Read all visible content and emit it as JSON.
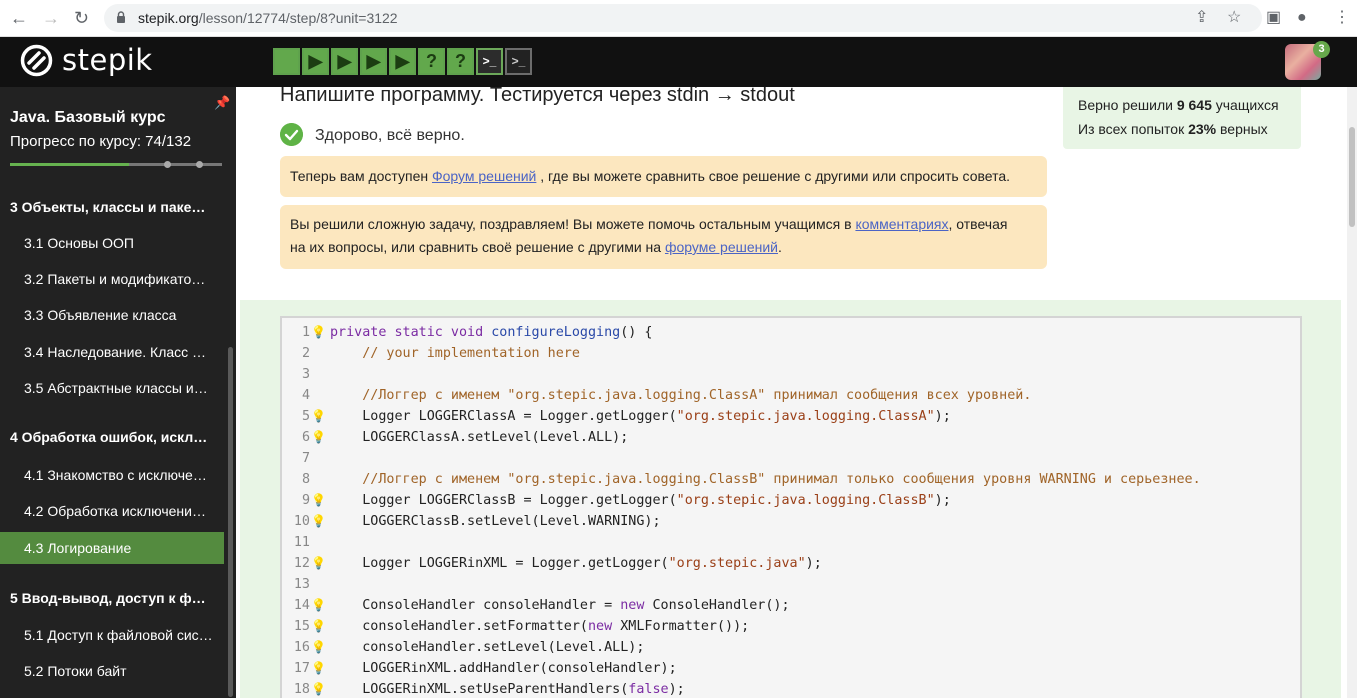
{
  "browser": {
    "url_host": "stepik.org",
    "url_path": "/lesson/12774/step/8?unit=3122"
  },
  "header": {
    "logo_text": "stepik",
    "step_buttons": [
      {
        "glyph": "",
        "kind": "green"
      },
      {
        "glyph": "▶",
        "kind": "green"
      },
      {
        "glyph": "▶",
        "kind": "green"
      },
      {
        "glyph": "▶",
        "kind": "green"
      },
      {
        "glyph": "▶",
        "kind": "green"
      },
      {
        "glyph": "?",
        "kind": "green"
      },
      {
        "glyph": "?",
        "kind": "green"
      },
      {
        "glyph": ">_",
        "kind": "term"
      },
      {
        "glyph": ">_",
        "kind": "dark"
      }
    ],
    "notifications_count": "3"
  },
  "sidebar": {
    "course_title": "Java. Базовый курс",
    "progress_label": "Прогресс по курсу:  74/132",
    "progress_fraction": 0.56,
    "items": [
      {
        "type": "section",
        "label": "3  Объекты, классы и паке…"
      },
      {
        "type": "item",
        "label": "3.1  Основы ООП"
      },
      {
        "type": "item",
        "label": "3.2  Пакеты и модификато…"
      },
      {
        "type": "item",
        "label": "3.3  Объявление класса"
      },
      {
        "type": "item",
        "label": "3.4  Наследование. Класс …"
      },
      {
        "type": "item",
        "label": "3.5  Абстрактные классы и…"
      },
      {
        "type": "section",
        "label": "4  Обработка ошибок, искл…"
      },
      {
        "type": "item",
        "label": "4.1  Знакомство с исключе…"
      },
      {
        "type": "item",
        "label": "4.2  Обработка исключени…"
      },
      {
        "type": "item",
        "label": "4.3  Логирование",
        "active": true
      },
      {
        "type": "section",
        "label": "5  Ввод-вывод, доступ к ф…"
      },
      {
        "type": "item",
        "label": "5.1  Доступ к файловой сис…"
      },
      {
        "type": "item",
        "label": "5.2  Потоки байт"
      }
    ]
  },
  "main": {
    "task_title": "Напишите программу. Тестируется через stdin → stdout",
    "success_text": "Здорово, всё верно.",
    "stats": {
      "line1_prefix": "Верно решили ",
      "line1_bold": "9 645",
      "line1_suffix": " учащихся",
      "line2_prefix": "Из всех попыток ",
      "line2_bold": "23%",
      "line2_suffix": " верных"
    },
    "note1": {
      "before": "Теперь вам доступен ",
      "link": "Форум решений",
      "after": " , где вы можете сравнить свое решение с другими или спросить совета."
    },
    "note2": {
      "line1_before": "Вы решили сложную задачу, поздравляем! Вы можете помочь остальным учащимся в ",
      "line1_link": "комментариях",
      "line1_after": ", отвечая",
      "line2_before": "на их вопросы, или сравнить своё решение с другими на ",
      "line2_link": "форуме решений",
      "line2_after": "."
    }
  },
  "code_lines": [
    {
      "n": "1",
      "bulb": true,
      "parts": [
        [
          "kw",
          "private"
        ],
        [
          "",
          ""
        ],
        [
          "",
          ""
        ],
        [
          "kw",
          " static"
        ],
        [
          "kw",
          " void"
        ],
        [
          "fn",
          " configureLogging"
        ],
        [
          "",
          "() {"
        ]
      ]
    },
    {
      "n": "2",
      "bulb": false,
      "parts": [
        [
          "cm",
          "    // your implementation here"
        ]
      ]
    },
    {
      "n": "3",
      "bulb": false,
      "parts": [
        [
          "",
          ""
        ]
      ]
    },
    {
      "n": "4",
      "bulb": false,
      "parts": [
        [
          "cm",
          "    //Логгер с именем \"org.stepic.java.logging.ClassA\" принимал сообщения всех уровней."
        ]
      ]
    },
    {
      "n": "5",
      "bulb": true,
      "parts": [
        [
          "",
          "    Logger LOGGERClassA = Logger.getLogger("
        ],
        [
          "st",
          "\"org.stepic.java.logging.ClassA\""
        ],
        [
          "",
          ");"
        ]
      ]
    },
    {
      "n": "6",
      "bulb": true,
      "parts": [
        [
          "",
          "    LOGGERClassA.setLevel(Level.ALL);"
        ]
      ]
    },
    {
      "n": "7",
      "bulb": false,
      "parts": [
        [
          "",
          ""
        ]
      ]
    },
    {
      "n": "8",
      "bulb": false,
      "parts": [
        [
          "cm",
          "    //Логгер с именем \"org.stepic.java.logging.ClassB\" принимал только сообщения уровня WARNING и серьезнее."
        ]
      ]
    },
    {
      "n": "9",
      "bulb": true,
      "parts": [
        [
          "",
          "    Logger LOGGERClassB = Logger.getLogger("
        ],
        [
          "st",
          "\"org.stepic.java.logging.ClassB\""
        ],
        [
          "",
          ");"
        ]
      ]
    },
    {
      "n": "10",
      "bulb": true,
      "parts": [
        [
          "",
          "    LOGGERClassB.setLevel(Level.WARNING);"
        ]
      ]
    },
    {
      "n": "11",
      "bulb": false,
      "parts": [
        [
          "",
          ""
        ]
      ]
    },
    {
      "n": "12",
      "bulb": true,
      "parts": [
        [
          "",
          "    Logger LOGGERinXML = Logger.getLogger("
        ],
        [
          "st",
          "\"org.stepic.java\""
        ],
        [
          "",
          ");"
        ]
      ]
    },
    {
      "n": "13",
      "bulb": false,
      "parts": [
        [
          "",
          ""
        ]
      ]
    },
    {
      "n": "14",
      "bulb": true,
      "parts": [
        [
          "",
          "    ConsoleHandler consoleHandler = "
        ],
        [
          "kw",
          "new"
        ],
        [
          "",
          " ConsoleHandler();"
        ]
      ]
    },
    {
      "n": "15",
      "bulb": true,
      "parts": [
        [
          "",
          "    consoleHandler.setFormatter("
        ],
        [
          "kw",
          "new"
        ],
        [
          "",
          " XMLFormatter());"
        ]
      ]
    },
    {
      "n": "16",
      "bulb": true,
      "parts": [
        [
          "",
          "    consoleHandler.setLevel(Level.ALL);"
        ]
      ]
    },
    {
      "n": "17",
      "bulb": true,
      "parts": [
        [
          "",
          "    LOGGERinXML.addHandler(consoleHandler);"
        ]
      ]
    },
    {
      "n": "18",
      "bulb": true,
      "parts": [
        [
          "",
          "    LOGGERinXML.setUseParentHandlers("
        ],
        [
          "kw",
          "false"
        ],
        [
          "",
          ");"
        ]
      ]
    }
  ]
}
